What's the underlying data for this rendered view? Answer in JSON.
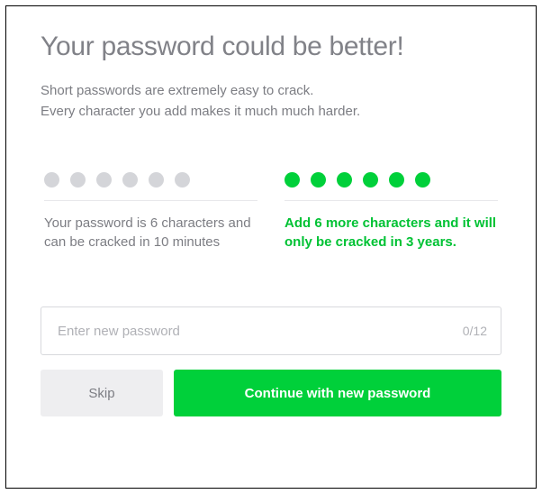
{
  "title": "Your password could be better!",
  "description_line1": "Short passwords are extremely easy to crack.",
  "description_line2": "Every character you add makes it much much harder.",
  "strength": {
    "weak": {
      "dot_count": 6,
      "dot_color": "#d4d5d9",
      "text": "Your password is 6 characters and can be cracked in 10 minutes"
    },
    "strong": {
      "dot_count": 6,
      "dot_color": "#00d03a",
      "text": "Add 6 more characters and it will only be cracked in 3 years."
    }
  },
  "input": {
    "placeholder": "Enter new password",
    "value": "",
    "counter": "0/12"
  },
  "buttons": {
    "skip": "Skip",
    "continue": "Continue with new password"
  },
  "colors": {
    "accent_green": "#00d03a",
    "text_muted": "#7c7d83",
    "dot_inactive": "#d4d5d9"
  }
}
